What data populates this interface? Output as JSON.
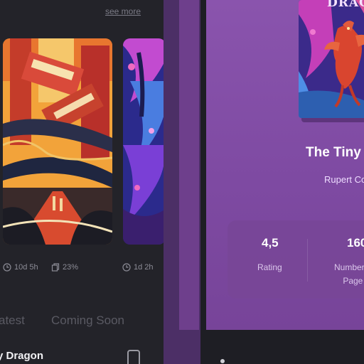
{
  "left_screen": {
    "see_more": "see more",
    "posters": [
      {
        "alt": "city-poster"
      },
      {
        "alt": "jungle-poster"
      }
    ],
    "meta": {
      "time_1": "10d 5h",
      "percent": "23%",
      "time_2": "1d 2h"
    },
    "tabs": {
      "latest": "atest",
      "coming_soon": "Coming Soon"
    },
    "list_item_title": "y Dragon"
  },
  "right_screen": {
    "cover_title": "DRAGO",
    "book_title": "The Tiny Dr",
    "book_author": "Rupert Co",
    "stats": {
      "rating_value": "4,5",
      "rating_label": "Rating",
      "pages_value": "160",
      "pages_label_line1": "Number o",
      "pages_label_line2": "Page"
    }
  },
  "colors": {
    "left_background": "#232329",
    "panel_purple": "#8a54ad",
    "stats_card": "#78469a",
    "text_muted": "#8c8c96"
  }
}
